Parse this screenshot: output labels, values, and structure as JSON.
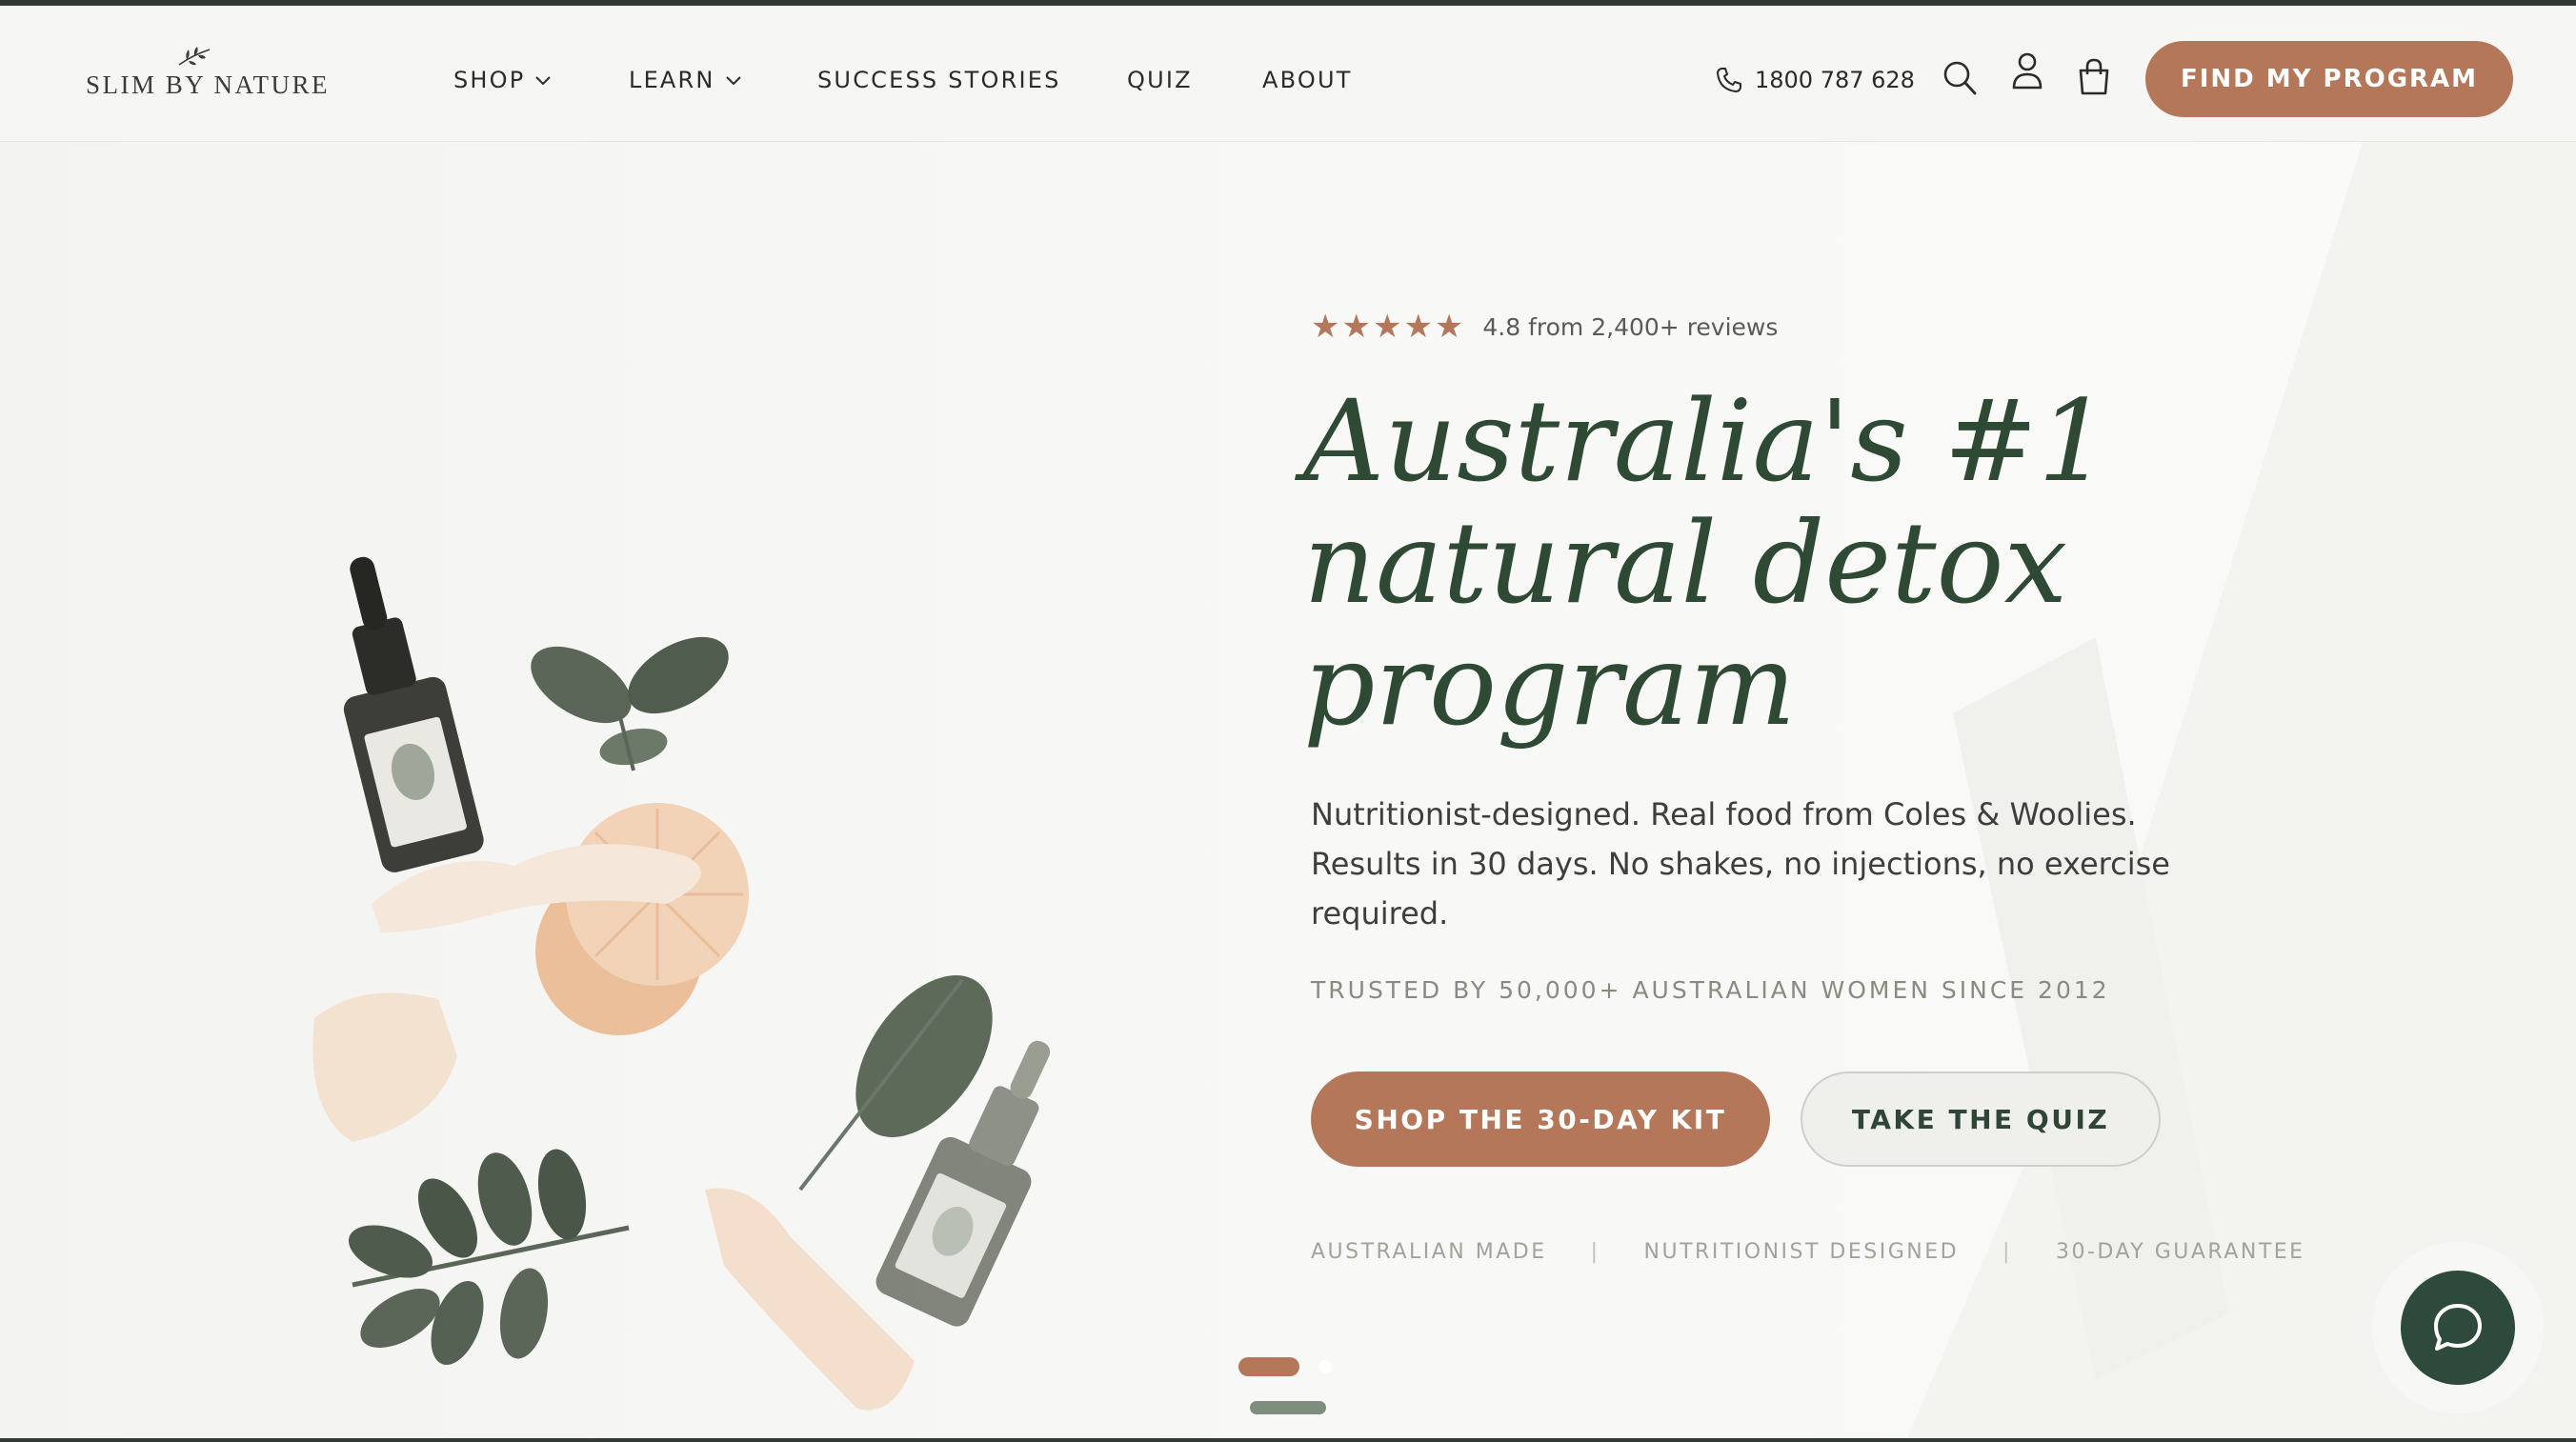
{
  "brand": {
    "logo_text": "SLIM BY NATURE",
    "accent_color": "#b5775a",
    "primary_green": "#2f4a34"
  },
  "nav": {
    "items": [
      {
        "label": "SHOP",
        "has_dropdown": true
      },
      {
        "label": "LEARN",
        "has_dropdown": true
      },
      {
        "label": "SUCCESS STORIES",
        "has_dropdown": false
      },
      {
        "label": "QUIZ",
        "has_dropdown": false
      },
      {
        "label": "ABOUT",
        "has_dropdown": false
      }
    ]
  },
  "header": {
    "phone": "1800 787 628",
    "phone_icon": "phone-icon",
    "search_icon": "search-icon",
    "account_icon": "user-icon",
    "cart_icon": "shopping-bag-icon",
    "cta_label": "FIND MY PROGRAM"
  },
  "hero": {
    "stars": "★★★★★",
    "star_count": 5,
    "rating_text": "4.8 from 2,400+ reviews",
    "headline_lines": [
      "Australia's #1",
      "natural detox",
      "program"
    ],
    "subheadline": "Nutritionist-designed. Real food from Coles & Woolies. Results in 30 days. No shakes, no injections, no exercise required.",
    "trusted": "TRUSTED BY 50,000+ AUSTRALIAN WOMEN SINCE 2012",
    "primary_button": "SHOP THE 30-DAY KIT",
    "secondary_button": "TAKE THE QUIZ",
    "badges": [
      "AUSTRALIAN MADE",
      "NUTRITIONIST DESIGNED",
      "30-DAY GUARANTEE"
    ],
    "badge_separator": "|"
  },
  "carousel": {
    "active_index": 0,
    "slide_count": 2
  },
  "chat": {
    "icon": "chat-bubble-icon"
  }
}
